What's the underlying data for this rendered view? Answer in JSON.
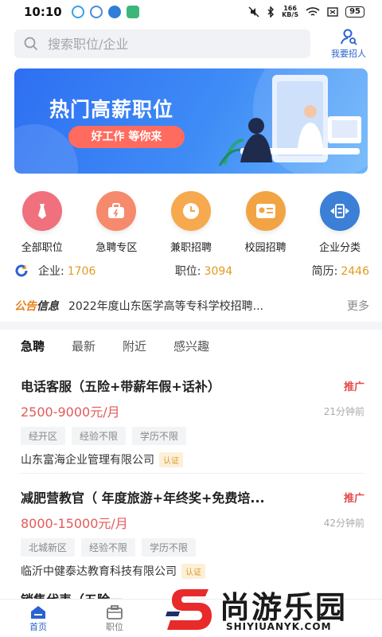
{
  "status_bar": {
    "time": "10:10",
    "speed_top": "166",
    "speed_bottom": "KB/S",
    "battery": "95"
  },
  "search": {
    "placeholder": "搜索职位/企业"
  },
  "header": {
    "recruit_label": "我要招人"
  },
  "banner": {
    "title": "热门高薪职位",
    "subtitle": "好工作 等你来"
  },
  "categories": [
    {
      "label": "全部职位",
      "icon": "tie-icon",
      "color": "#f0707e"
    },
    {
      "label": "急聘专区",
      "icon": "briefcase-icon",
      "color": "#f68a6c"
    },
    {
      "label": "兼职招聘",
      "icon": "clock-icon",
      "color": "#f6a94e"
    },
    {
      "label": "校园招聘",
      "icon": "id-card-icon",
      "color": "#f2a445"
    },
    {
      "label": "企业分类",
      "icon": "hire-icon",
      "color": "#3b7fd6"
    }
  ],
  "stats": {
    "company_label": "企业:",
    "company_value": "1706",
    "jobs_label": "职位:",
    "jobs_value": "3094",
    "resume_label": "简历:",
    "resume_value": "2446"
  },
  "notice": {
    "tag_a": "公告",
    "tag_b": "信息",
    "text": "2022年度山东医学高等专科学校招聘...",
    "more": "更多"
  },
  "tabs": [
    {
      "label": "急聘",
      "active": true
    },
    {
      "label": "最新",
      "active": false
    },
    {
      "label": "附近",
      "active": false
    },
    {
      "label": "感兴趣",
      "active": false
    }
  ],
  "jobs": [
    {
      "title": "电话客服（五险+带薪年假+话补）",
      "promo": "推广",
      "salary": "2500-9000元/月",
      "time": "21分钟前",
      "tags": [
        "经开区",
        "经验不限",
        "学历不限"
      ],
      "company": "山东富海企业管理有限公司",
      "verified": "认证"
    },
    {
      "title": "减肥营教官（ 年度旅游+年终奖+免费培...",
      "promo": "推广",
      "salary": "8000-15000元/月",
      "time": "42分钟前",
      "tags": [
        "北城新区",
        "经验不限",
        "学历不限"
      ],
      "company": "临沂中健泰达教育科技有限公司",
      "verified": "认证"
    }
  ],
  "partial_job_title": "销售代表（五险一",
  "bottom_nav": [
    {
      "label": "首页",
      "icon": "home-icon",
      "active": true
    },
    {
      "label": "职位",
      "icon": "briefcase-nav-icon",
      "active": false
    }
  ],
  "watermark": {
    "main": "尚游乐园",
    "sub": "SHIYIUANYK.COM"
  },
  "colors": {
    "accent": "#2a62d0",
    "salary": "#e35a5a",
    "stat_value": "#e29a1e",
    "promo": "#e34b4b"
  }
}
